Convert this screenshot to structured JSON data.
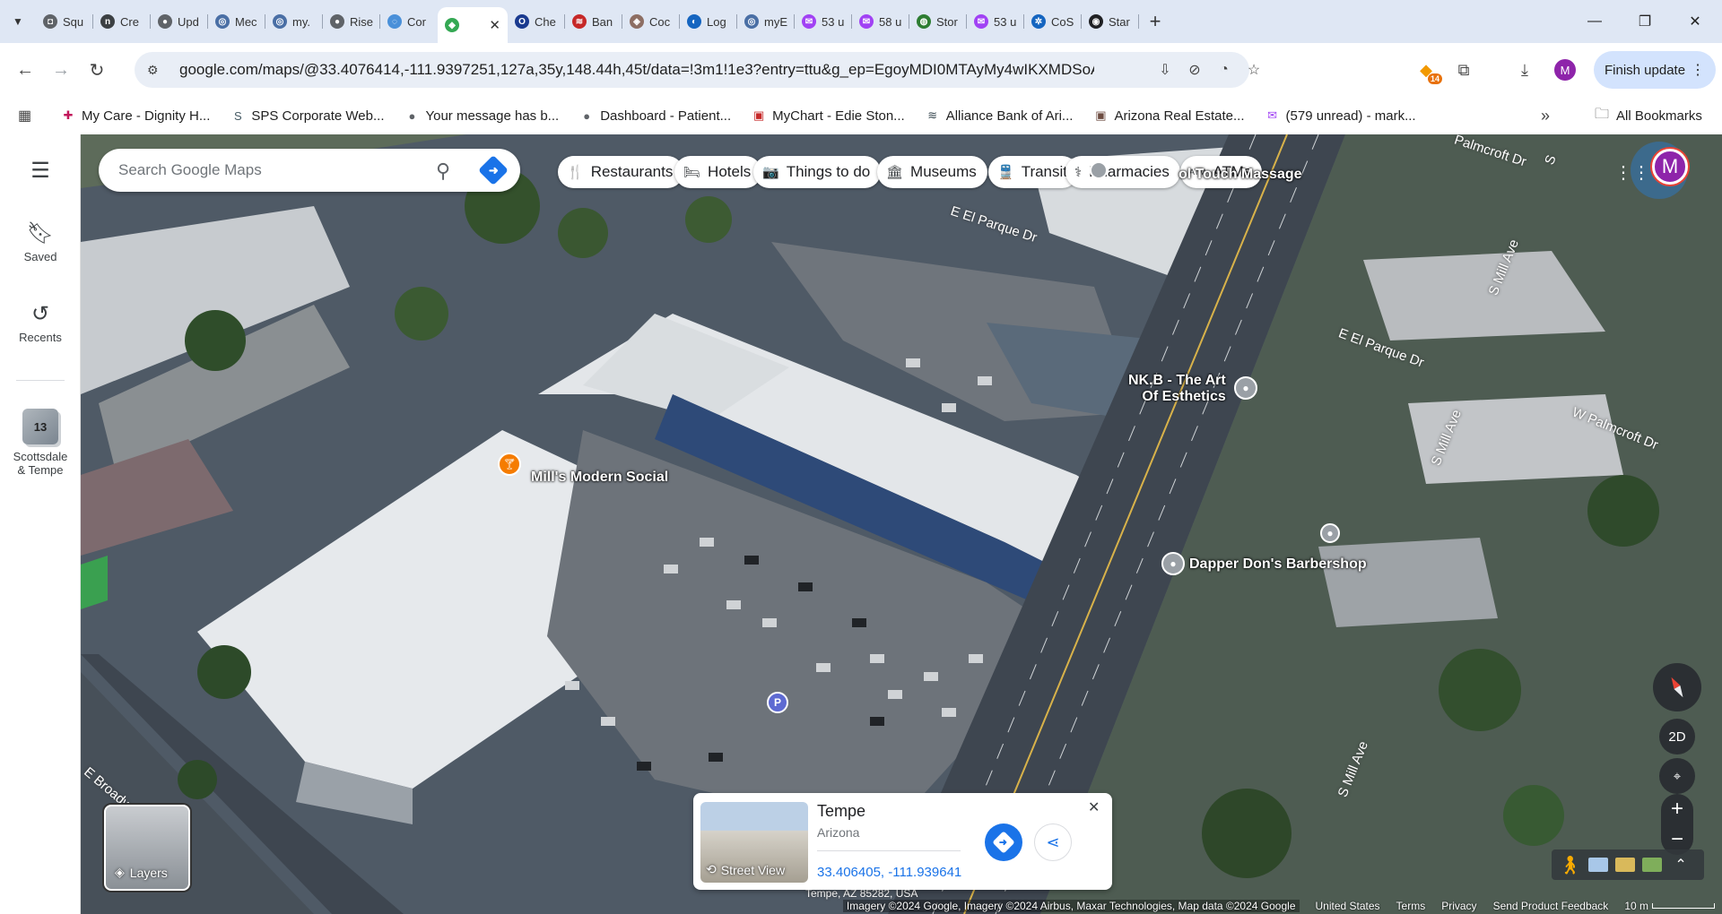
{
  "browser": {
    "tabs": [
      {
        "title": "Squ",
        "color": "#5f6368",
        "glyph": "◘"
      },
      {
        "title": "Cre",
        "color": "#3c4043",
        "glyph": "n"
      },
      {
        "title": "Upd",
        "color": "#5f6368",
        "glyph": "●"
      },
      {
        "title": "Mec",
        "color": "#4a6fa5",
        "glyph": "◎"
      },
      {
        "title": "my.",
        "color": "#4a6fa5",
        "glyph": "◎"
      },
      {
        "title": "Rise",
        "color": "#5f6368",
        "glyph": "●"
      },
      {
        "title": "Cor",
        "color": "#4a90d9",
        "glyph": "◌"
      },
      {
        "title": "",
        "color": "#34a853",
        "glyph": "◆"
      },
      {
        "title": "Che",
        "color": "#1a3a8f",
        "glyph": "O"
      },
      {
        "title": "Ban",
        "color": "#c62828",
        "glyph": "≋"
      },
      {
        "title": "Coc",
        "color": "#8d6e63",
        "glyph": "◈"
      },
      {
        "title": "Log",
        "color": "#1565c0",
        "glyph": "◐"
      },
      {
        "title": "myE",
        "color": "#4a6fa5",
        "glyph": "◎"
      },
      {
        "title": "53 u",
        "color": "#a142f4",
        "glyph": "✉"
      },
      {
        "title": "58 u",
        "color": "#a142f4",
        "glyph": "✉"
      },
      {
        "title": "Stor",
        "color": "#2e7d32",
        "glyph": "◍"
      },
      {
        "title": "53 u",
        "color": "#a142f4",
        "glyph": "✉"
      },
      {
        "title": "CoS",
        "color": "#1565c0",
        "glyph": "✲"
      },
      {
        "title": "Star",
        "color": "#202124",
        "glyph": "◉"
      }
    ],
    "active_tab_close": "✕",
    "new_tab": "+",
    "window_controls": {
      "minimize": "—",
      "restore": "❐",
      "close": "✕"
    },
    "url": "google.com/maps/@33.4076414,-111.9397251,127a,35y,148.44h,45t/data=!3m1!1e3?entry=ttu&g_ep=EgoyMDI0MTAyMy4wIKXMDSoASAFQAw%3D%...",
    "extension_badge": "14",
    "profile_initial": "M",
    "finish_update": "Finish update",
    "bookmarks": [
      {
        "label": "My Care - Dignity H...",
        "icon": "✚",
        "color": "#c2185b"
      },
      {
        "label": "SPS Corporate Web...",
        "icon": "S",
        "color": "#455a64"
      },
      {
        "label": "Your message has b...",
        "icon": "●",
        "color": "#5f6368"
      },
      {
        "label": "Dashboard - Patient...",
        "icon": "●",
        "color": "#5f6368"
      },
      {
        "label": "MyChart - Edie Ston...",
        "icon": "▣",
        "color": "#c62828"
      },
      {
        "label": "Alliance Bank of Ari...",
        "icon": "≋",
        "color": "#37474f"
      },
      {
        "label": "Arizona Real Estate...",
        "icon": "▣",
        "color": "#6d4c41"
      },
      {
        "label": "(579 unread) - mark...",
        "icon": "✉",
        "color": "#a142f4"
      }
    ],
    "all_bookmarks": "All Bookmarks"
  },
  "maps": {
    "rail": {
      "saved": "Saved",
      "recents": "Recents",
      "recent_place_count": "13",
      "recent_place_label_1": "Scottsdale",
      "recent_place_label_2": "& Tempe"
    },
    "search_placeholder": "Search Google Maps",
    "chips": [
      {
        "label": "Restaurants",
        "icon": "🍴"
      },
      {
        "label": "Hotels",
        "icon": "🛏"
      },
      {
        "label": "Things to do",
        "icon": "📷"
      },
      {
        "label": "Museums",
        "icon": "🏛"
      },
      {
        "label": "Transit",
        "icon": "🚆"
      },
      {
        "label": "Pharmacies",
        "icon": "⚕"
      },
      {
        "label": "ATMs",
        "icon": "ATM"
      }
    ],
    "account_initial": "M",
    "places": {
      "mills": "Mill's Modern Social",
      "nkb_1": "NK.B - The Art",
      "nkb_2": "Of Esthetics",
      "dapper": "Dapper Don's Barbershop",
      "touch": "ol Touch Massage",
      "parking": "P"
    },
    "streets": {
      "parque1": "E El Parque Dr",
      "parque2": "E El Parque Dr",
      "mill1": "S Mill Ave",
      "mill2": "S Mill Ave",
      "mill3": "S Mill Ave",
      "mill4": "S",
      "palmcroft1": "W Palmcroft Dr",
      "palmcroft2": "Palmcroft Dr",
      "broadway": "E Broadw"
    },
    "layers": "Layers",
    "card": {
      "name": "Tempe",
      "region": "Arizona",
      "coords": "33.406405, -111.939641",
      "street_view": "Street View",
      "close": "✕"
    },
    "controls": {
      "twod": "2D",
      "zoom_in": "+",
      "zoom_out": "−"
    },
    "attribution": {
      "imagery": "Imagery ©2024 Google, Imagery ©2024 Airbus, Maxar Technologies, Map data ©2024 Google",
      "country": "United States",
      "terms": "Terms",
      "privacy": "Privacy",
      "feedback": "Send Product Feedback",
      "scale": "10 m"
    },
    "address_fragment": "Tempe, AZ 85282, USA"
  }
}
